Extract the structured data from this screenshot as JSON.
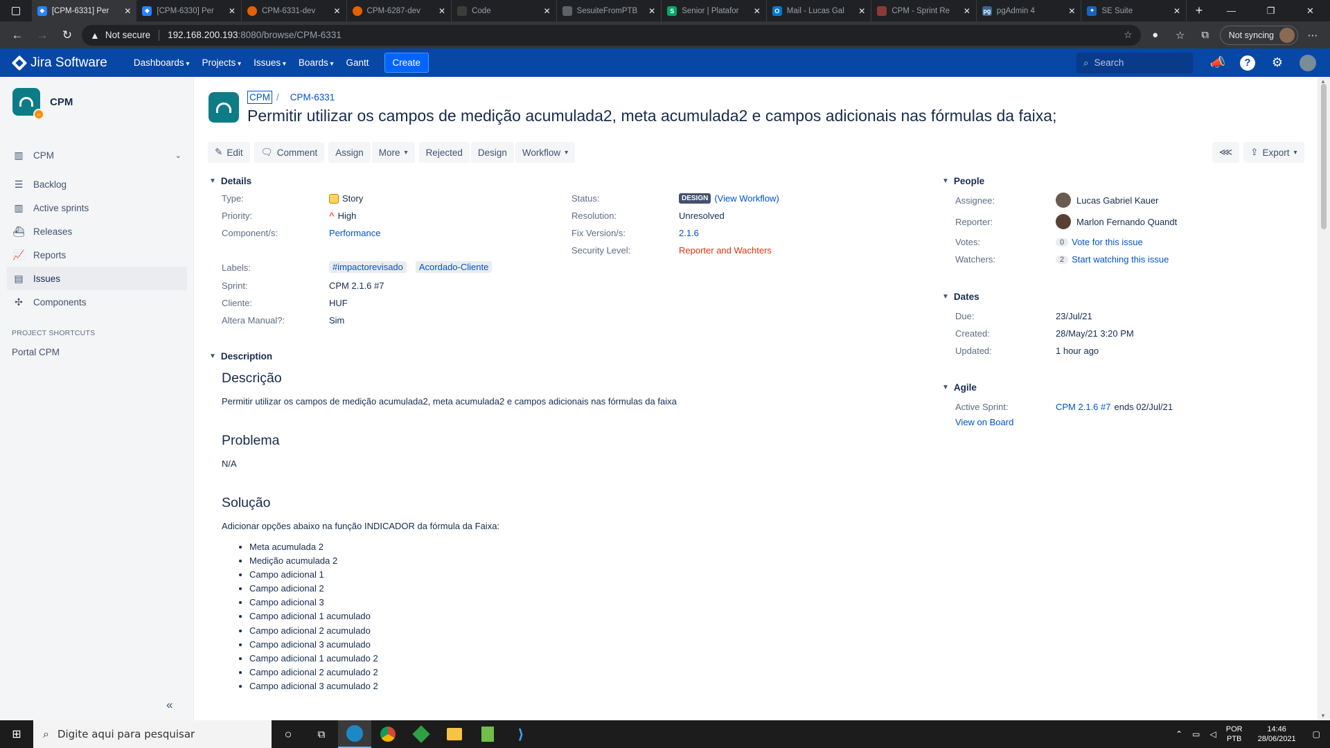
{
  "browser": {
    "tabs": [
      {
        "title": "[CPM-6331] Per",
        "icon": "jira",
        "active": true
      },
      {
        "title": "[CPM-6330] Per",
        "icon": "jira"
      },
      {
        "title": "CPM-6331-dev",
        "icon": "firefox-like"
      },
      {
        "title": "CPM-6287-dev",
        "icon": "firefox-like"
      },
      {
        "title": "Code",
        "icon": "code"
      },
      {
        "title": "SesuiteFromPTB",
        "icon": "sesuite"
      },
      {
        "title": "Senior | Platafor",
        "icon": "senior"
      },
      {
        "title": "Mail - Lucas Gal",
        "icon": "outlook"
      },
      {
        "title": "CPM - Sprint Re",
        "icon": "sprint"
      },
      {
        "title": "pgAdmin 4",
        "icon": "pgadmin"
      },
      {
        "title": "SE Suite",
        "icon": "sesuite2"
      }
    ],
    "security_text": "Not secure",
    "url_host": "192.168.200.193",
    "url_rest": ":8080/browse/CPM-6331",
    "sync_label": "Not syncing"
  },
  "jira": {
    "logo_text": "Jira Software",
    "nav": [
      "Dashboards",
      "Projects",
      "Issues",
      "Boards",
      "Gantt"
    ],
    "create_label": "Create",
    "search_placeholder": "Search"
  },
  "sidebar": {
    "project_name": "CPM",
    "board_label": "CPM",
    "items": [
      {
        "label": "Backlog",
        "icon": "backlog-icon"
      },
      {
        "label": "Active sprints",
        "icon": "board-icon"
      },
      {
        "label": "Releases",
        "icon": "ship-icon"
      },
      {
        "label": "Reports",
        "icon": "chart-icon"
      },
      {
        "label": "Issues",
        "icon": "issues-icon",
        "selected": true
      },
      {
        "label": "Components",
        "icon": "puzzle-icon"
      }
    ],
    "shortcuts_heading": "PROJECT SHORTCUTS",
    "shortcut": "Portal CPM"
  },
  "issue": {
    "project_key": "CPM",
    "key": "CPM-6331",
    "title": "Permitir utilizar os campos de medição acumulada2, meta acumulada2 e campos adicionais nas fórmulas da faixa;",
    "toolbar": {
      "edit": "Edit",
      "comment": "Comment",
      "assign": "Assign",
      "more": "More",
      "rejected": "Rejected",
      "design": "Design",
      "workflow": "Workflow",
      "export": "Export"
    },
    "details_heading": "Details",
    "details": {
      "type_label": "Type:",
      "type_value": "Story",
      "priority_label": "Priority:",
      "priority_value": "High",
      "component_label": "Component/s:",
      "component_value": "Performance",
      "labels_label": "Labels:",
      "labels": [
        "#impactorevisado",
        "Acordado-Cliente"
      ],
      "sprint_label": "Sprint:",
      "sprint_value": "CPM 2.1.6 #7",
      "cliente_label": "Cliente:",
      "cliente_value": "HUF",
      "altera_label": "Altera Manual?:",
      "altera_value": "Sim",
      "status_label": "Status:",
      "status_value": "DESIGN",
      "view_workflow": "(View Workflow)",
      "resolution_label": "Resolution:",
      "resolution_value": "Unresolved",
      "fixversion_label": "Fix Version/s:",
      "fixversion_value": "2.1.6",
      "security_label": "Security Level:",
      "security_value": "Reporter and Wachters"
    },
    "description_heading": "Description",
    "description": {
      "h1": "Descrição",
      "p1": "Permitir utilizar os campos de medição acumulada2, meta acumulada2 e campos adicionais nas fórmulas da faixa",
      "h2": "Problema",
      "p2": "N/A",
      "h3": "Solução",
      "p3": "Adicionar opções abaixo na função INDICADOR da fórmula da Faixa:",
      "list": [
        "Meta acumulada 2",
        "Medição acumulada 2",
        "Campo adicional 1",
        "Campo adicional 2",
        "Campo adicional 3",
        "Campo adicional 1 acumulado",
        "Campo adicional 2 acumulado",
        "Campo adicional 3 acumulado",
        "Campo adicional 1 acumulado 2",
        "Campo adicional 2 acumulado 2",
        "Campo adicional 3 acumulado 2"
      ]
    },
    "people_heading": "People",
    "people": {
      "assignee_label": "Assignee:",
      "assignee": "Lucas Gabriel Kauer",
      "reporter_label": "Reporter:",
      "reporter": "Marlon Fernando Quandt",
      "votes_label": "Votes:",
      "votes_count": "0",
      "votes_link": "Vote for this issue",
      "watchers_label": "Watchers:",
      "watchers_count": "2",
      "watchers_link": "Start watching this issue"
    },
    "dates_heading": "Dates",
    "dates": {
      "due_label": "Due:",
      "due": "23/Jul/21",
      "created_label": "Created:",
      "created": "28/May/21 3:20 PM",
      "updated_label": "Updated:",
      "updated": "1 hour ago"
    },
    "agile_heading": "Agile",
    "agile": {
      "active_sprint_label": "Active Sprint:",
      "active_sprint": "CPM 2.1.6 #7",
      "ends": "ends 02/Jul/21",
      "view_on_board": "View on Board"
    }
  },
  "taskbar": {
    "search_placeholder": "Digite aqui para pesquisar",
    "lang1": "POR",
    "lang2": "PTB",
    "time": "14:46",
    "date": "28/06/2021"
  }
}
